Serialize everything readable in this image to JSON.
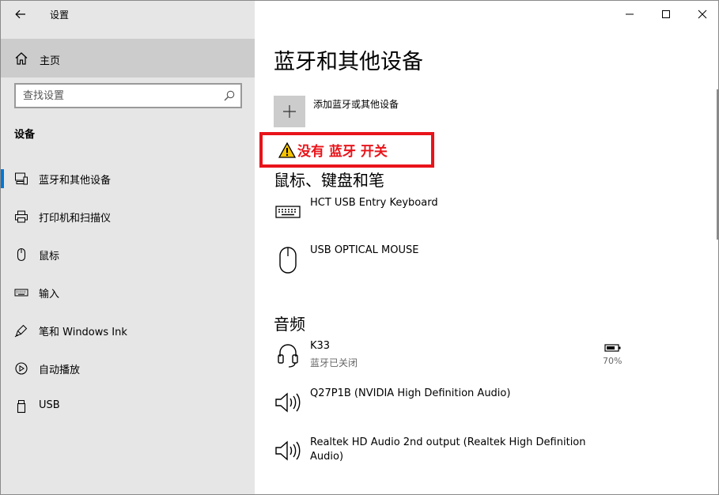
{
  "window": {
    "title": "设置",
    "controls": {
      "minimize": "minimize",
      "maximize": "maximize",
      "close": "close"
    }
  },
  "sidebar": {
    "home_label": "主页",
    "search_placeholder": "查找设置",
    "section_title": "设备",
    "items": [
      {
        "label": "蓝牙和其他设备",
        "icon": "bluetooth-devices-icon",
        "active": true
      },
      {
        "label": "打印机和扫描仪",
        "icon": "printer-icon"
      },
      {
        "label": "鼠标",
        "icon": "mouse-icon"
      },
      {
        "label": "输入",
        "icon": "keyboard-icon"
      },
      {
        "label": "笔和 Windows Ink",
        "icon": "pen-icon"
      },
      {
        "label": "自动播放",
        "icon": "autoplay-icon"
      },
      {
        "label": "USB",
        "icon": "usb-icon"
      }
    ]
  },
  "main": {
    "title": "蓝牙和其他设备",
    "add_device_label": "添加蓝牙或其他设备",
    "annotation_text": "没有 蓝牙 开关",
    "groups": {
      "input": {
        "title": "鼠标、键盘和笔",
        "devices": [
          {
            "name": "HCT USB Entry Keyboard",
            "icon": "keyboard-icon"
          },
          {
            "name": "USB OPTICAL MOUSE",
            "icon": "mouse-icon"
          }
        ]
      },
      "audio": {
        "title": "音频",
        "devices": [
          {
            "name": "K33",
            "status": "蓝牙已关闭",
            "battery": "70%",
            "icon": "headset-icon"
          },
          {
            "name": "Q27P1B (NVIDIA High Definition Audio)",
            "icon": "speaker-icon"
          },
          {
            "name": "Realtek HD Audio 2nd output (Realtek High Definition Audio)",
            "icon": "speaker-icon"
          }
        ]
      }
    }
  },
  "colors": {
    "sidebar_bg": "#e6e6e6",
    "home_selected_bg": "#cccccc",
    "accent": "#0078d7",
    "annotation_red": "#e8141a"
  }
}
